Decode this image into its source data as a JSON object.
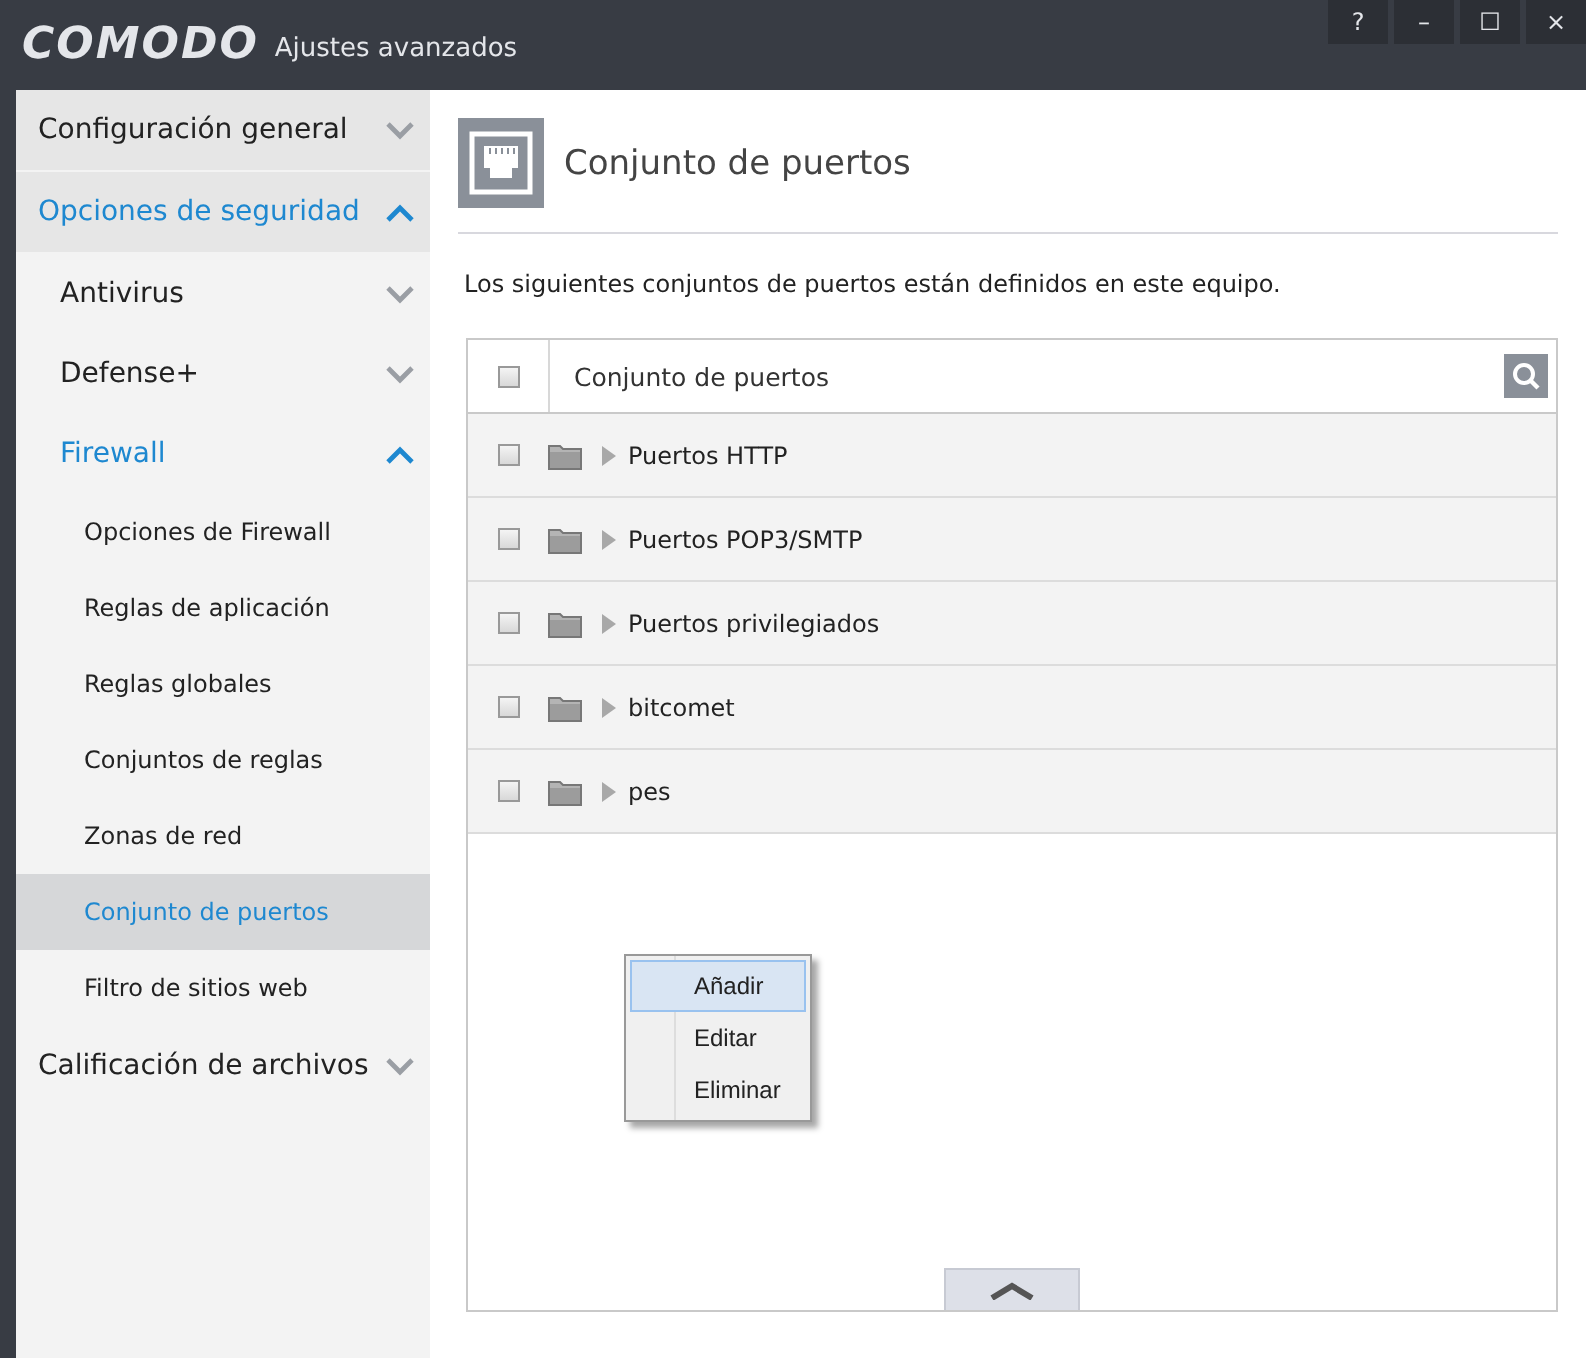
{
  "window": {
    "logo": "COMODO",
    "title": "Ajustes avanzados",
    "controls": [
      "?",
      "–",
      "☐",
      "×"
    ]
  },
  "sidebar": {
    "items": [
      {
        "label": "Configuración general",
        "expanded": false,
        "selected": false
      },
      {
        "label": "Opciones de seguridad",
        "expanded": true,
        "selected": true,
        "children": [
          {
            "label": "Antivirus",
            "expanded": false,
            "selected": false
          },
          {
            "label": "Defense+",
            "expanded": false,
            "selected": false
          },
          {
            "label": "Firewall",
            "expanded": true,
            "selected": true,
            "children": [
              {
                "label": "Opciones de Firewall",
                "selected": false
              },
              {
                "label": "Reglas de aplicación",
                "selected": false
              },
              {
                "label": "Reglas globales",
                "selected": false
              },
              {
                "label": "Conjuntos de reglas",
                "selected": false
              },
              {
                "label": "Zonas de red",
                "selected": false
              },
              {
                "label": "Conjunto de puertos",
                "selected": true
              },
              {
                "label": "Filtro de sitios web",
                "selected": false
              }
            ]
          }
        ]
      },
      {
        "label": "Calificación de archivos",
        "expanded": false,
        "selected": false
      }
    ]
  },
  "page": {
    "title": "Conjunto de puertos",
    "description": "Los siguientes conjuntos de puertos están definidos en este equipo."
  },
  "table": {
    "header_checked": false,
    "column": "Conjunto de puertos",
    "rows": [
      {
        "name": "Puertos HTTP",
        "checked": false
      },
      {
        "name": "Puertos POP3/SMTP",
        "checked": false
      },
      {
        "name": "Puertos privilegiados",
        "checked": false
      },
      {
        "name": "bitcomet",
        "checked": false
      },
      {
        "name": "pes",
        "checked": false
      }
    ]
  },
  "context_menu": {
    "items": [
      {
        "label": "Añadir",
        "selected": true
      },
      {
        "label": "Editar",
        "selected": false
      },
      {
        "label": "Eliminar",
        "selected": false
      }
    ]
  }
}
